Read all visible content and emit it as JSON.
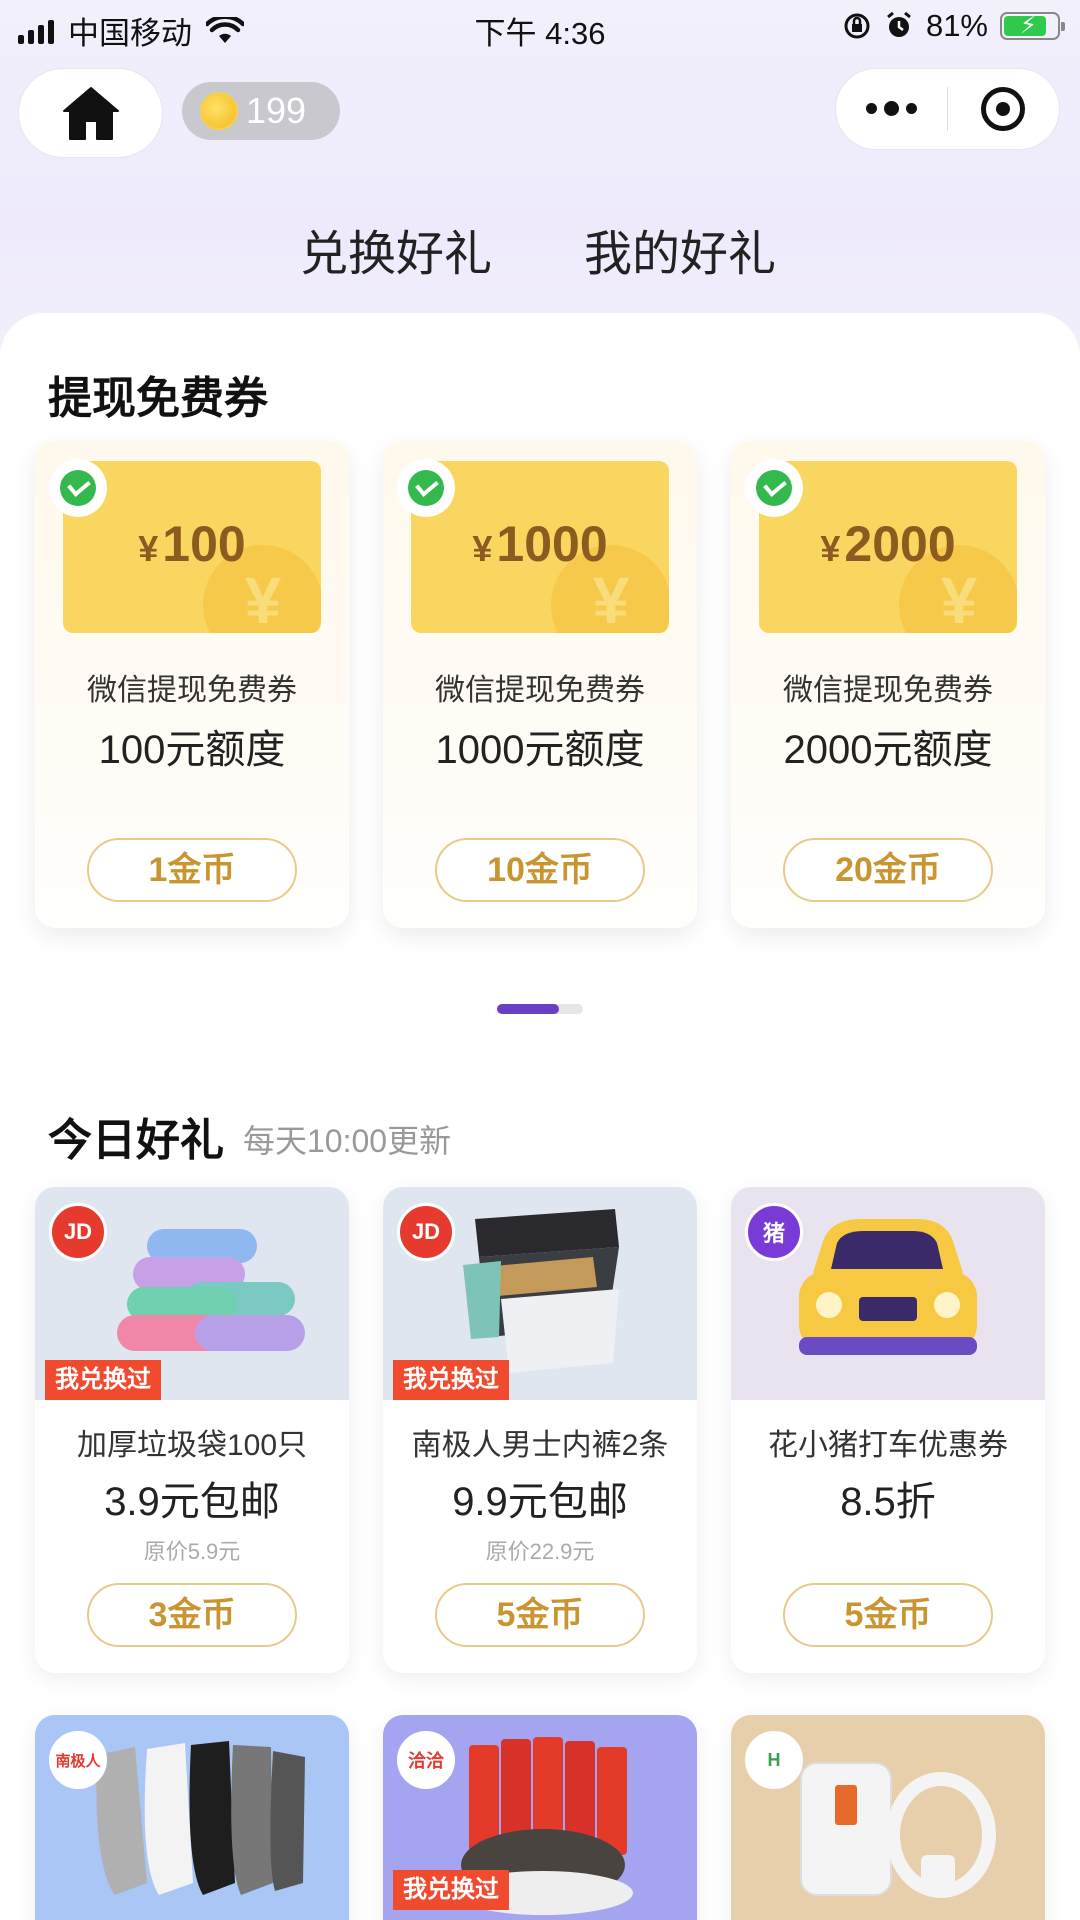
{
  "status_bar": {
    "carrier": "中国移动",
    "time": "下午 4:36",
    "battery": "81%",
    "battery_level": 0.81
  },
  "header": {
    "coins": "199",
    "tabs": [
      {
        "label": "兑换好礼",
        "active": true
      },
      {
        "label": "我的好礼",
        "active": false
      }
    ]
  },
  "free_coupon_section": {
    "title": "提现免费券",
    "cards": [
      {
        "amount": "100",
        "currency": "¥",
        "line1": "微信提现免费券",
        "line2": "100元额度",
        "price": "1金币"
      },
      {
        "amount": "1000",
        "currency": "¥",
        "line1": "微信提现免费券",
        "line2": "1000元额度",
        "price": "10金币"
      },
      {
        "amount": "2000",
        "currency": "¥",
        "line1": "微信提现免费券",
        "line2": "2000元额度",
        "price": "20金币"
      }
    ],
    "pager": {
      "current": 1,
      "total": 2
    }
  },
  "today_gifts": {
    "title": "今日好礼",
    "subtitle": "每天10:00更新",
    "items": [
      {
        "brand_icon": "jd-dog-icon",
        "name": "加厚垃圾袋100只",
        "deal": "3.9元包邮",
        "original": "原价5.9元",
        "price": "3金币",
        "tag": "我兑换过"
      },
      {
        "brand_icon": "jd-dog-icon",
        "name": "南极人男士内裤2条",
        "deal": "9.9元包邮",
        "original": "原价22.9元",
        "price": "5金币",
        "tag": "我兑换过"
      },
      {
        "brand_icon": "huaxiaozhu-pig-icon",
        "name": "花小猪打车优惠券",
        "deal": "8.5折",
        "original": "",
        "price": "5金币",
        "tag": ""
      }
    ],
    "more_items": [
      {
        "brand": "南极人",
        "tag": ""
      },
      {
        "brand": "洽洽",
        "tag": "我兑换过"
      },
      {
        "brand": "",
        "tag": ""
      }
    ]
  },
  "colors": {
    "accent_purple": "#6a3fc4",
    "gold_text": "#c99530",
    "coupon_yellow": "#f9d65f",
    "tag_red": "#f04b2f"
  }
}
